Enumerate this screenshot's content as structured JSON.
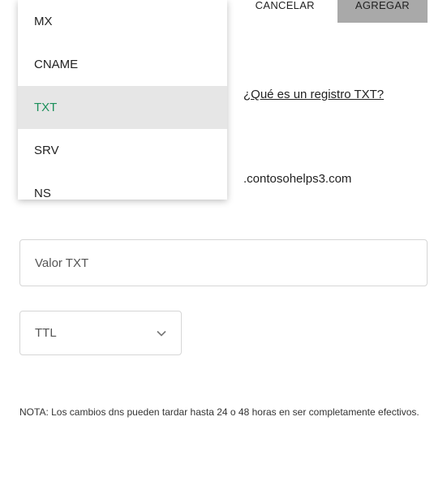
{
  "record_type_dropdown": {
    "options": [
      "MX",
      "CNAME",
      "TXT",
      "SRV",
      "NS"
    ],
    "selected_index": 2
  },
  "help_link": "¿Qué es un registro TXT?",
  "domain_suffix": ".contosohelps3.com",
  "txt_value_placeholder": "Valor TXT",
  "ttl_placeholder": "TTL",
  "note_text": "NOTA: Los cambios dns pueden tardar hasta 24 o 48 horas en ser completamente efectivos.",
  "buttons": {
    "cancel": "CANCELAR",
    "add": "AGREGAR"
  },
  "colors": {
    "selected_text": "#1b8f5a",
    "selected_bg": "#e6e6e6",
    "add_btn_bg": "#a9a9a9"
  }
}
